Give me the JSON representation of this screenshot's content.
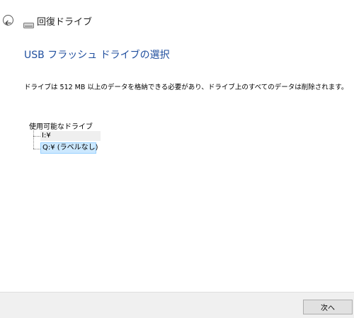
{
  "window": {
    "title": "回復ドライブ",
    "back_icon": "back-arrow-icon",
    "drive_icon": "drive-icon"
  },
  "main": {
    "heading": "USB フラッシュ ドライブの選択",
    "description": "ドライブは 512 MB 以上のデータを格納できる必要があり、ドライブ上のすべてのデータは削除されます。",
    "drives_label": "使用可能なドライブ",
    "drives": [
      {
        "label": "I:¥",
        "selected": false
      },
      {
        "label": "Q:¥ (ラベルなし)",
        "selected": true
      }
    ]
  },
  "footer": {
    "next_label": "次へ"
  },
  "colors": {
    "heading": "#1f4e9e",
    "selection_bg": "#cce8ff",
    "selection_border": "#99d1ff",
    "footer_bg": "#f0f0f0"
  }
}
